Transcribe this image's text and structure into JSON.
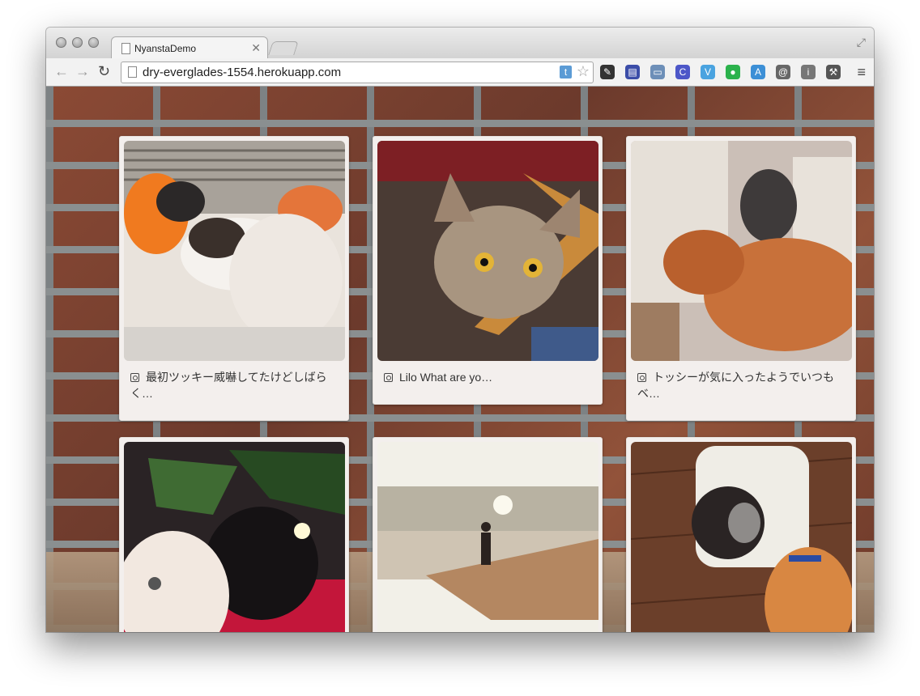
{
  "browser": {
    "tab_title": "NyanstaDemo",
    "url": "dry-everglades-1554.herokuapp.com",
    "omnibox_badge": "t",
    "menu_icon": "hamburger-menu-icon"
  },
  "extensions": [
    {
      "name": "pin-icon",
      "color": "#333333"
    },
    {
      "name": "feed-icon",
      "color": "#3b4da8"
    },
    {
      "name": "window-icon",
      "color": "#6d8fb8"
    },
    {
      "name": "c-icon",
      "color": "#4d57c8"
    },
    {
      "name": "v-icon",
      "color": "#4aa3e0"
    },
    {
      "name": "green-balloon-icon",
      "color": "#2bb24c"
    },
    {
      "name": "translate-icon",
      "color": "#3c8fd6"
    },
    {
      "name": "mail-icon",
      "color": "#666666"
    },
    {
      "name": "info-icon",
      "color": "#777777"
    },
    {
      "name": "wrench-icon",
      "color": "#555555"
    }
  ],
  "posts": [
    {
      "caption": "最初ツッキー威嚇してたけどしばらく…",
      "photo": "cats-on-bed",
      "icon": "instagram-icon"
    },
    {
      "caption": "Lilo What are yo…",
      "photo": "tabby-cat",
      "icon": "instagram-icon"
    },
    {
      "caption": "トッシーが気に入ったようでいつもベ…",
      "photo": "cats-on-tower",
      "icon": "instagram-icon"
    },
    {
      "caption": "",
      "photo": "cats-under-tree",
      "icon": "instagram-icon"
    },
    {
      "caption": "",
      "photo": "beach-silhouette",
      "icon": "instagram-icon"
    },
    {
      "caption": "",
      "photo": "cats-with-carrier",
      "icon": "instagram-icon"
    }
  ]
}
